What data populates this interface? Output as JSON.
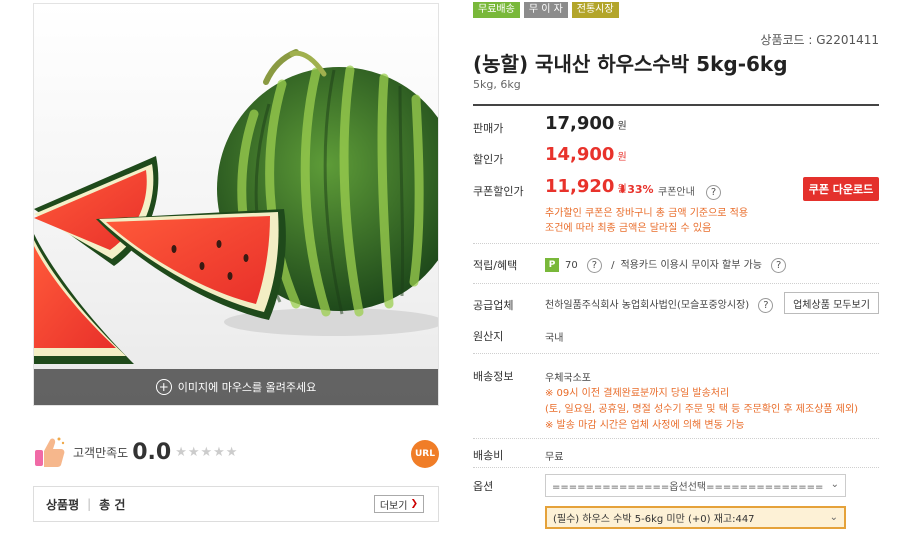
{
  "badges": [
    {
      "label": "무료배송",
      "color": "#79b83a"
    },
    {
      "label": "무 이 자",
      "color": "#8c8c8c"
    },
    {
      "label": "전통시장",
      "color": "#b3a52a"
    }
  ],
  "product": {
    "code_label": "상품코드 : G2201411",
    "title": "(농할) 국내산 하우스수박 5kg-6kg",
    "subtitle": "5kg, 6kg"
  },
  "image": {
    "hint": "이미지에 마우스를 올려주세요",
    "zoom_icon": "+"
  },
  "satisfaction": {
    "label": "고객만족도",
    "score": "0.0",
    "stars": "★★★★★",
    "url_label": "URL"
  },
  "review": {
    "title": "상품평",
    "sep": "|",
    "count": "총 건",
    "more_label": "더보기",
    "more_chev": "❯"
  },
  "pricing": {
    "sale_label": "판매가",
    "sale_price": "17,900",
    "discount_label": "할인가",
    "discount_price": "14,900",
    "coupon_label": "쿠폰할인가",
    "coupon_price": "11,920",
    "won": "원",
    "discount_rate": "⬇33%",
    "coupon_guide": "쿠폰안내",
    "coupon_button": "쿠폰 다운로드",
    "coupon_note_1": "추가할인 쿠폰은 장바구니 총 금액 기준으로 적용",
    "coupon_note_2": "조건에 따라 최종 금액은 달라질 수 있음"
  },
  "benefit": {
    "label": "적립/혜택",
    "point_badge": "P",
    "points": "70",
    "slash": "/",
    "card_text": "적용카드 이용시 무이자 할부 가능"
  },
  "seller": {
    "label": "공급업체",
    "name": "천하일품주식회사 농업회사법인(모슬포중앙시장)",
    "all_products_button": "업체상품 모두보기"
  },
  "origin": {
    "label": "원산지",
    "value": "국내"
  },
  "shipping": {
    "label": "배송정보",
    "method": "우체국소포",
    "note_1": "※ 09시 이전 결제완료분까지 당일 발송처리",
    "note_2": "(토, 일요일, 공휴일, 명절 성수기 주문 및 택 등 주문확인 후 제조상품 제외)",
    "note_3": "※ 발송 마감 시간은 업체 사정에 의해 변동 가능",
    "fee_label": "배송비",
    "fee": "무료"
  },
  "options": {
    "label": "옵션",
    "select_placeholder": "==============옵션선택==============",
    "selected_value": "(필수) 하우스 수박 5-6kg 미만 (+0) 재고:447",
    "arrow": "⌄"
  },
  "question_mark": "?"
}
